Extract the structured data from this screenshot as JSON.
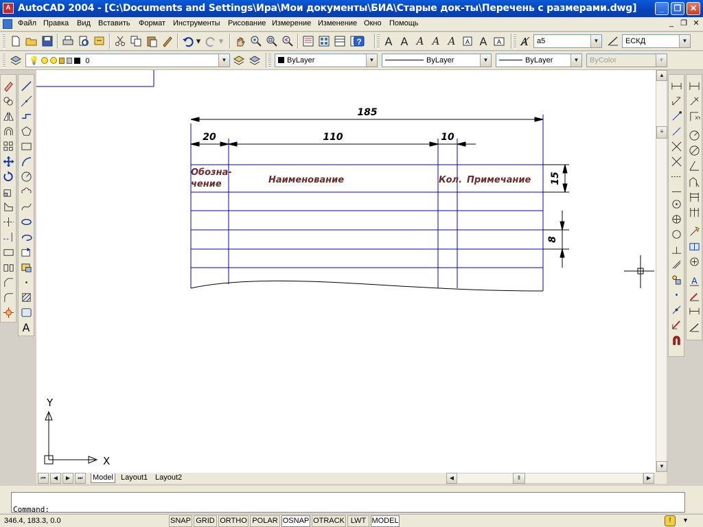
{
  "window": {
    "title": "AutoCAD 2004 - [C:\\Documents and Settings\\Ира\\Мои документы\\БИА\\Старые док-ты\\Перечень с размерами.dwg]",
    "minimize_glyph": "_",
    "maximize_glyph": "❐",
    "close_glyph": "✕"
  },
  "menu": {
    "items": [
      "Файл",
      "Правка",
      "Вид",
      "Вставить",
      "Формат",
      "Инструменты",
      "Рисование",
      "Измерение",
      "Изменение",
      "Окно",
      "Помощь"
    ],
    "mdi_minimize": "_",
    "mdi_restore": "❐",
    "mdi_close": "✕"
  },
  "toolbar_styles": {
    "text_style": "а5",
    "dim_style": "ЕСКД"
  },
  "toolbar_props": {
    "layer": "0",
    "color": "ByLayer",
    "linetype": "ByLayer",
    "lineweight": "ByLayer",
    "plotstyle": "ByColor"
  },
  "drawing": {
    "dim_total": "185",
    "dim_col1": "20",
    "dim_col2": "110",
    "dim_col3": "10",
    "dim_header_height": "15",
    "dim_row_height": "8",
    "header_designation_1": "Обозна-",
    "header_designation_2": "чение",
    "header_name": "Наименование",
    "header_qty": "Кол.",
    "header_note": "Примечание",
    "ucs_y": "Y",
    "ucs_x": "X"
  },
  "tabs": {
    "model": "Model",
    "layout1": "Layout1",
    "layout2": "Layout2"
  },
  "command": {
    "prompt": "Command:"
  },
  "status": {
    "coords": "346.4, 183.3, 0.0",
    "buttons": [
      "SNAP",
      "GRID",
      "ORTHO",
      "POLAR",
      "OSNAP",
      "OTRACK",
      "LWT",
      "MODEL"
    ]
  },
  "colors": {
    "titlebar": "#0842b8",
    "table_lines": "#0000c8",
    "header_text": "#6b2a2a",
    "canvas": "#ffffff"
  }
}
